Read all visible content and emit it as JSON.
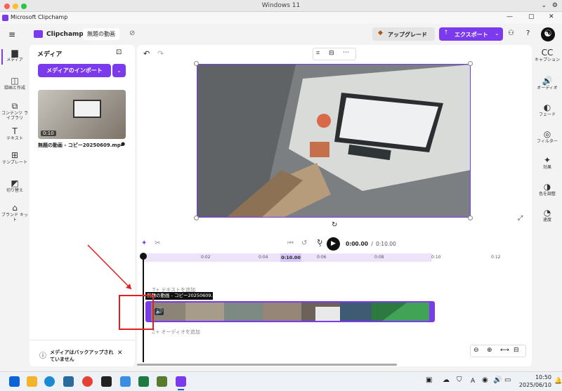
{
  "os": {
    "title": "Windows 11"
  },
  "window": {
    "title": "Microsoft Clipchamp",
    "min": "—",
    "max": "▢",
    "close": "✕"
  },
  "header": {
    "app_name": "Clipchamp",
    "project_title": "無題の動画",
    "upgrade_label": "アップグレード",
    "export_label": "エクスポート",
    "help": "?"
  },
  "rail": {
    "items": [
      {
        "label": "メディア",
        "icon": "folder-icon",
        "glyph": "▆"
      },
      {
        "label": "録画と作成",
        "icon": "camera-icon",
        "glyph": "◫"
      },
      {
        "label": "コンテンツ ライブラリ",
        "icon": "library-icon",
        "glyph": "⧉"
      },
      {
        "label": "テキスト",
        "icon": "text-icon",
        "glyph": "T"
      },
      {
        "label": "テンプレート",
        "icon": "template-icon",
        "glyph": "⊞"
      },
      {
        "label": "切り替え",
        "icon": "transition-icon",
        "glyph": "◩"
      },
      {
        "label": "ブランド キット",
        "icon": "brand-icon",
        "glyph": "⌂"
      }
    ]
  },
  "media_panel": {
    "title": "メディア",
    "import_label": "メディアのインポート",
    "thumb_duration": "0:10",
    "file_name": "無題の動画 - コピー20250609.mp4",
    "backup_notice": "メディアはバックアップされていません"
  },
  "player": {
    "time_current": "0:00.00",
    "time_sep": " / ",
    "time_total": "0:10.00",
    "speed": "5"
  },
  "timeline": {
    "ticks": [
      "0:02",
      "0:04",
      "0:06",
      "0:08",
      "0:10",
      "0:12"
    ],
    "playhead_label": "0:10.00",
    "clip_label": "無題の動画 - コピー20250609.mp4",
    "add_text": "T+ テキストを追加",
    "add_audio": "♫+ オーディオを追加"
  },
  "right_rail": {
    "items": [
      {
        "label": "キャプション",
        "icon": "caption-icon",
        "glyph": "CC"
      },
      {
        "label": "オーディオ",
        "icon": "speaker-icon",
        "glyph": "🔊"
      },
      {
        "label": "フェード",
        "icon": "fade-icon",
        "glyph": "◐"
      },
      {
        "label": "フィルター",
        "icon": "filter-icon",
        "glyph": "◎"
      },
      {
        "label": "効果",
        "icon": "effects-icon",
        "glyph": "✦"
      },
      {
        "label": "色を調整",
        "icon": "color-icon",
        "glyph": "◑"
      },
      {
        "label": "速度",
        "icon": "speed-icon",
        "glyph": "◔"
      }
    ]
  },
  "taskbar": {
    "time": "10:50",
    "date": "2025/06/10",
    "lang": "A"
  },
  "colors": {
    "accent": "#7c3aed",
    "annotation": "#e02020"
  }
}
